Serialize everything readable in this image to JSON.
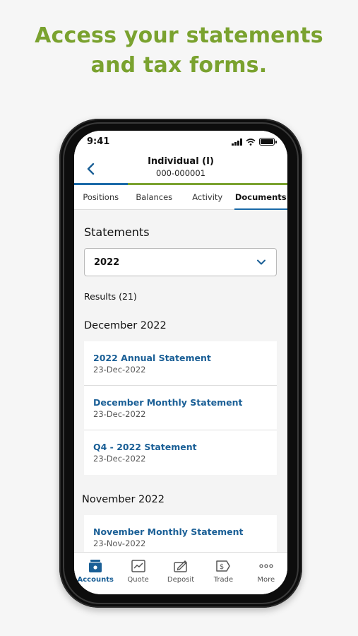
{
  "headline": {
    "line1": "Access your statements",
    "line2": "and tax forms."
  },
  "status_bar": {
    "time": "9:41"
  },
  "header": {
    "title": "Individual (I)",
    "account_number": "000-000001"
  },
  "tabs": [
    {
      "label": "Positions",
      "active": false
    },
    {
      "label": "Balances",
      "active": false
    },
    {
      "label": "Activity",
      "active": false
    },
    {
      "label": "Documents",
      "active": true
    }
  ],
  "statements": {
    "title": "Statements",
    "year_select": {
      "value": "2022"
    },
    "results": "Results (21)",
    "groups": [
      {
        "month": "December 2022",
        "items": [
          {
            "title": "2022 Annual Statement",
            "date": "23-Dec-2022"
          },
          {
            "title": "December Monthly Statement",
            "date": "23-Dec-2022"
          },
          {
            "title": "Q4 - 2022 Statement",
            "date": "23-Dec-2022"
          }
        ]
      },
      {
        "month": "November 2022",
        "items": [
          {
            "title": "November Monthly Statement",
            "date": "23-Nov-2022"
          }
        ]
      }
    ]
  },
  "bottom_nav": [
    {
      "label": "Accounts",
      "icon": "accounts-icon",
      "active": true
    },
    {
      "label": "Quote",
      "icon": "chart-icon",
      "active": false
    },
    {
      "label": "Deposit",
      "icon": "check-deposit-icon",
      "active": false
    },
    {
      "label": "Trade",
      "icon": "dollar-tag-icon",
      "active": false
    },
    {
      "label": "More",
      "icon": "more-dots-icon",
      "active": false
    }
  ],
  "colors": {
    "accent_green": "#7aa22f",
    "link_blue": "#1a5f96",
    "tab_blue": "#1a6aa8"
  }
}
